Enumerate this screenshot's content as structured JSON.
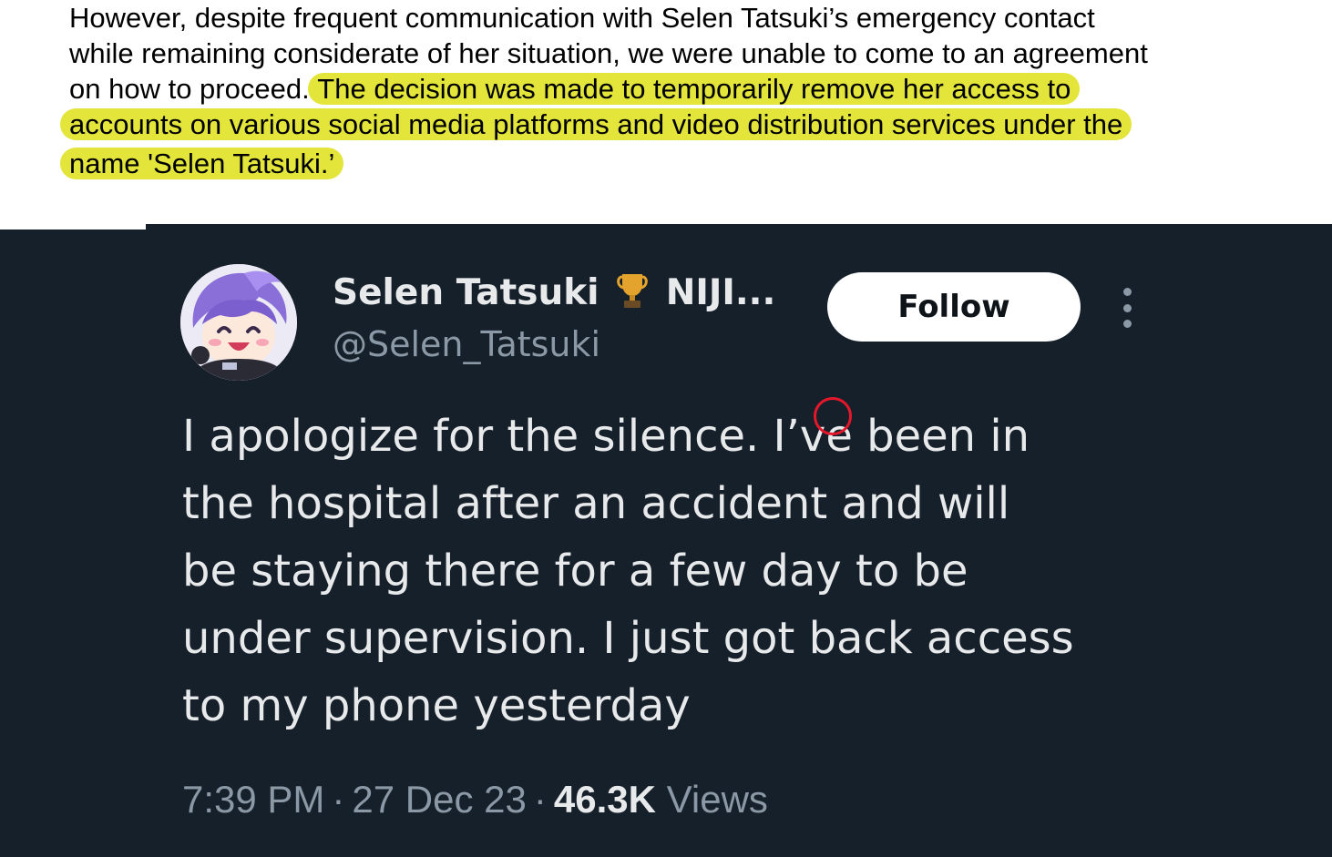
{
  "document": {
    "line1": "However, despite frequent communication with Selen Tatsuki’s emergency contact",
    "line2": "while remaining considerate of her situation, we were unable to come to an agreement",
    "line3_plain": "on how to proceed. ",
    "line3_highlight": "The decision was made to temporarily remove her access to",
    "line4_highlight": "accounts on various social media platforms and video distribution services under the",
    "line5_highlight": "name 'Selen Tatsuki.’",
    "highlight_color": "#e3e53a"
  },
  "tweet": {
    "display_name": "Selen Tatsuki",
    "display_name_suffix": "NIJI...",
    "badge_icon": "trophy-icon",
    "handle": "@Selen_Tatsuki",
    "follow_label": "Follow",
    "more_icon": "more-options-icon",
    "text_lines": [
      "I apologize for the silence. I’ve been in",
      "the hospital after an accident and will",
      "be staying there for a few day to be",
      "under supervision. I just got back access",
      "to my phone yesterday"
    ],
    "time": "7:39 PM",
    "date": "27 Dec 23",
    "separator": "·",
    "views_count": "46.3K",
    "views_label": "Views",
    "annotation_color": "#e4172b",
    "background": "#15202b"
  }
}
